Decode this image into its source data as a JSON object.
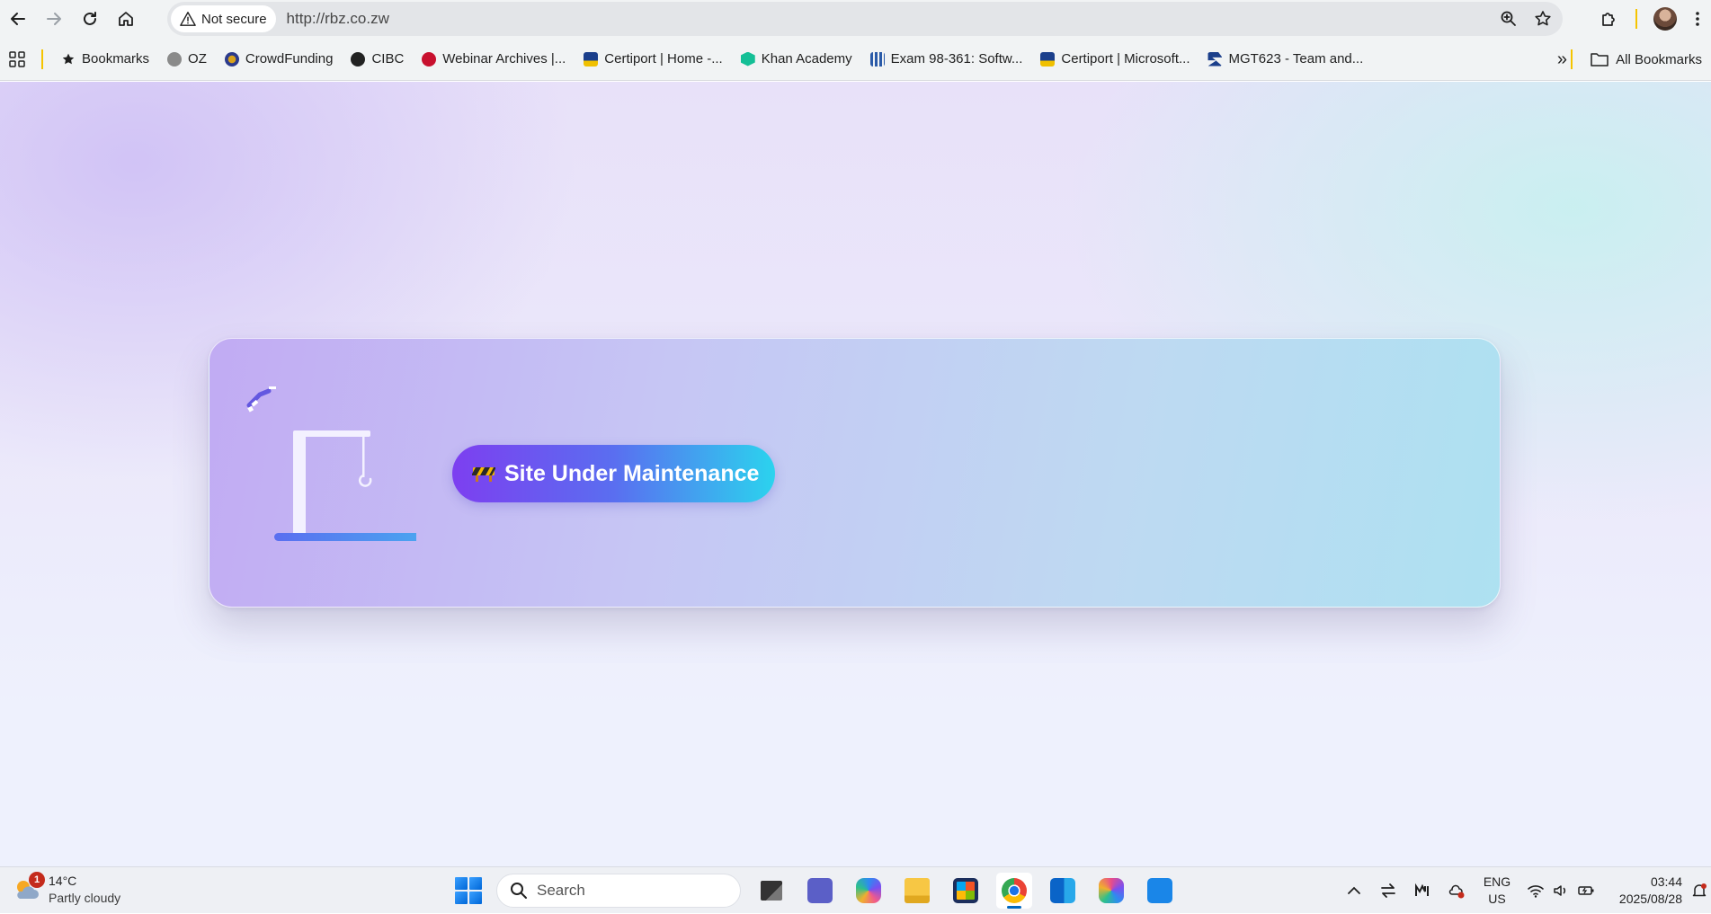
{
  "browser": {
    "security_label": "Not secure",
    "url": "http://rbz.co.zw"
  },
  "bookmarks": {
    "items": [
      {
        "label": "Bookmarks",
        "icon": "star-icon",
        "color": "#1f1f1f"
      },
      {
        "label": "OZ",
        "icon": "oz-favicon",
        "color": "#6b6b6b"
      },
      {
        "label": "CrowdFunding",
        "icon": "crowdfunding-favicon",
        "color": "#2b3a8c"
      },
      {
        "label": "CIBC",
        "icon": "cibc-favicon",
        "color": "#222222"
      },
      {
        "label": "Webinar Archives |...",
        "icon": "webinar-favicon",
        "color": "#c8102e"
      },
      {
        "label": "Certiport | Home -...",
        "icon": "certiport-favicon",
        "color": "#1b3f8b"
      },
      {
        "label": "Khan Academy",
        "icon": "khan-academy-favicon",
        "color": "#14bf96"
      },
      {
        "label": "Exam 98-361: Softw...",
        "icon": "exam-favicon",
        "color": "#2a5aa8"
      },
      {
        "label": "Certiport | Microsoft...",
        "icon": "certiport-favicon",
        "color": "#1b3f8b"
      },
      {
        "label": "MGT623 - Team and...",
        "icon": "mgt623-favicon",
        "color": "#1b3f8b"
      }
    ],
    "all_bookmarks_label": "All Bookmarks"
  },
  "page": {
    "status_label": "Site Under Maintenance",
    "colors": {
      "pill_start": "#7d3ff0",
      "pill_end": "#2bd3ee",
      "crane_base": "#5a6ef0"
    }
  },
  "taskbar": {
    "weather": {
      "temperature": "14°C",
      "condition": "Partly cloudy",
      "notification_count": "1"
    },
    "search_placeholder": "Search",
    "apps": [
      "file-explorer-icon",
      "teams-icon",
      "copilot-icon",
      "folder-icon",
      "store-icon",
      "chrome-icon",
      "outlook-icon",
      "m365-icon",
      "phone-link-icon"
    ],
    "language": "ENG",
    "region": "US",
    "time": "03:44",
    "date": "2025/08/28"
  }
}
